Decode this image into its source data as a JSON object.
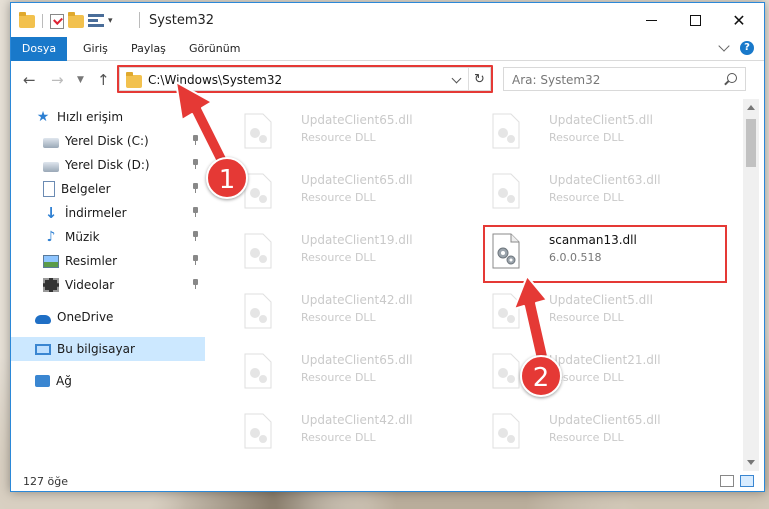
{
  "window": {
    "title": "System32"
  },
  "ribbon": {
    "tabs": [
      "Dosya",
      "Giriş",
      "Paylaş",
      "Görünüm"
    ],
    "help_label": "?"
  },
  "navigation": {
    "address": "C:\\Windows\\System32",
    "search_placeholder": "Ara: System32"
  },
  "sidebar": {
    "items": [
      {
        "label": "Hızlı erişim",
        "icon": "star-icon"
      },
      {
        "label": "Yerel Disk (C:)",
        "icon": "drive-icon",
        "pinned": true
      },
      {
        "label": "Yerel Disk (D:)",
        "icon": "drive-icon",
        "pinned": true
      },
      {
        "label": "Belgeler",
        "icon": "documents-icon",
        "pinned": true
      },
      {
        "label": "İndirmeler",
        "icon": "downloads-icon",
        "pinned": true
      },
      {
        "label": "Müzik",
        "icon": "music-icon",
        "pinned": true
      },
      {
        "label": "Resimler",
        "icon": "pictures-icon",
        "pinned": true
      },
      {
        "label": "Videolar",
        "icon": "videos-icon",
        "pinned": true
      },
      {
        "label": "OneDrive",
        "icon": "onedrive-icon"
      },
      {
        "label": "Bu bilgisayar",
        "icon": "this-pc-icon",
        "selected": true
      },
      {
        "label": "Ağ",
        "icon": "network-icon"
      }
    ]
  },
  "files": [
    {
      "name": "UpdateClient65.dll",
      "type": "Resource DLL"
    },
    {
      "name": "UpdateClient5.dll",
      "type": "Resource DLL"
    },
    {
      "name": "UpdateClient65.dll",
      "type": "Resource DLL"
    },
    {
      "name": "UpdateClient63.dll",
      "type": "Resource DLL"
    },
    {
      "name": "UpdateClient19.dll",
      "type": "Resource DLL"
    },
    {
      "name": "scanman13.dll",
      "type": "6.0.0.518",
      "selected": true
    },
    {
      "name": "UpdateClient42.dll",
      "type": "Resource DLL"
    },
    {
      "name": "UpdateClient5.dll",
      "type": "Resource DLL"
    },
    {
      "name": "UpdateClient65.dll",
      "type": "Resource DLL"
    },
    {
      "name": "UpdateClient21.dll",
      "type": "Resource DLL"
    },
    {
      "name": "UpdateClient42.dll",
      "type": "Resource DLL"
    },
    {
      "name": "UpdateClient65.dll",
      "type": "Resource DLL"
    }
  ],
  "status": {
    "item_count": "127 öğe"
  },
  "callouts": {
    "one": "1",
    "two": "2",
    "color": "#e53935"
  },
  "colors": {
    "accent": "#1979ca",
    "selection": "#cce8ff",
    "highlight": "#e53935"
  }
}
